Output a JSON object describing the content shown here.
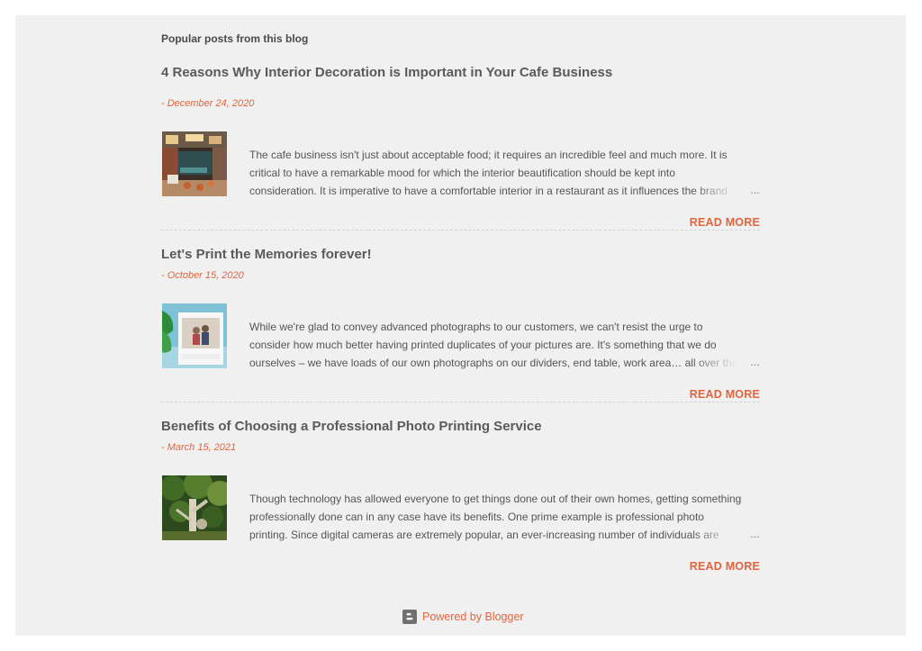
{
  "section": {
    "title": "Popular posts from this blog"
  },
  "posts": [
    {
      "title": "4 Reasons Why Interior Decoration is Important in Your Cafe Business",
      "date": "- December 24, 2020",
      "snippet": [
        "The cafe business isn't just about acceptable food; it requires an incredible feel and much more. It is",
        "critical to have a remarkable mood for which the interior beautification should be kept into",
        "consideration.  It is imperative to have a comfortable interior in a restaurant as it influences the brand"
      ],
      "ellipsis": "…",
      "read_more": "READ MORE",
      "thumb_icon": "cafe-interior-thumbnail"
    },
    {
      "title": "Let's Print the Memories forever!",
      "date": "- October 15, 2020",
      "snippet": [
        "While we're glad to convey advanced photographs to our customers, we can't resist the urge to",
        "consider how much better having printed duplicates of your pictures are. It's something that we do",
        "ourselves – we have loads of our own photographs on our dividers, end table, work area… all over the"
      ],
      "ellipsis": "…",
      "read_more": "READ MORE",
      "thumb_icon": "printed-photo-thumbnail"
    },
    {
      "title": "Benefits of Choosing a Professional Photo Printing Service",
      "date": "- March 15, 2021",
      "snippet": [
        "Though technology has allowed everyone to get things done out of their own homes, getting something",
        "professionally done can in any case have its benefits. One prime example is professional photo",
        "printing. Since digital cameras are extremely popular, an ever-increasing number of individuals are"
      ],
      "ellipsis": "…",
      "read_more": "READ MORE",
      "thumb_icon": "tree-nature-thumbnail"
    }
  ],
  "footer": {
    "text": "Powered by Blogger",
    "icon": "blogger-icon"
  },
  "colors": {
    "accent": "#e2643e",
    "panel_bg": "#f0f0f0",
    "title_text": "#5a5a5a",
    "body_text": "#555555"
  }
}
